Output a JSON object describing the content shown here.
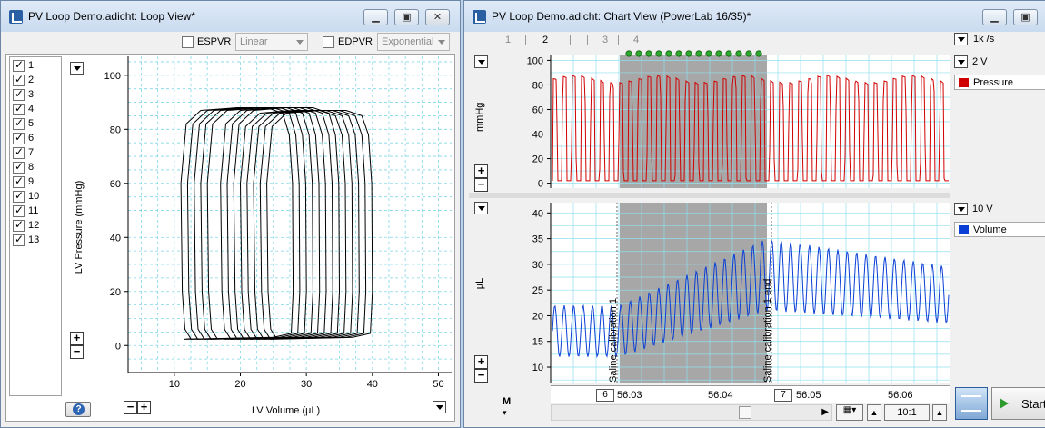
{
  "loop_window": {
    "title": "PV Loop Demo.adicht: Loop View*",
    "espvr": {
      "label": "ESPVR",
      "checked": false,
      "mode": "Linear"
    },
    "edpvr": {
      "label": "EDPVR",
      "checked": false,
      "mode": "Exponential"
    },
    "loops": [
      {
        "label": "1",
        "checked": true
      },
      {
        "label": "2",
        "checked": true
      },
      {
        "label": "3",
        "checked": true
      },
      {
        "label": "4",
        "checked": true
      },
      {
        "label": "5",
        "checked": true
      },
      {
        "label": "6",
        "checked": true
      },
      {
        "label": "7",
        "checked": true
      },
      {
        "label": "8",
        "checked": true
      },
      {
        "label": "9",
        "checked": true
      },
      {
        "label": "10",
        "checked": true
      },
      {
        "label": "11",
        "checked": true
      },
      {
        "label": "12",
        "checked": true
      },
      {
        "label": "13",
        "checked": true
      }
    ],
    "plot": {
      "xlabel": "LV Volume (µL)",
      "ylabel": "LV Pressure (mmHg)",
      "xticks": [
        10,
        20,
        30,
        40,
        50
      ],
      "yticks": [
        0,
        20,
        40,
        60,
        80,
        100
      ],
      "xlim": [
        3,
        52
      ],
      "ylim": [
        -10,
        107
      ]
    }
  },
  "chart_window": {
    "title": "PV Loop Demo.adicht: Chart View (PowerLab 16/35)*",
    "sample_rate": "1k /s",
    "blocks": [
      "1",
      "2",
      "3",
      "4"
    ],
    "channels": [
      {
        "name": "Pressure",
        "unit": "mmHg",
        "range": "2 V",
        "color": "#d10000",
        "yticks": [
          0,
          20,
          40,
          60,
          80,
          100
        ],
        "ylim": [
          -4,
          104
        ]
      },
      {
        "name": "Volume",
        "unit": "µL",
        "range": "10 V",
        "color": "#0a3fd6",
        "yticks": [
          10,
          15,
          20,
          25,
          30,
          35,
          40
        ],
        "ylim": [
          7,
          42
        ]
      }
    ],
    "time_ticks": [
      "56:03",
      "56:04",
      "56:05",
      "56:06"
    ],
    "comments": [
      {
        "number": "6",
        "text": "Saline calibration 1"
      },
      {
        "number": "7",
        "text": "Saline calibration 1 end"
      }
    ],
    "zoom": "10:1",
    "start_label": "Start"
  },
  "chart_data": [
    {
      "type": "line",
      "title": "",
      "xlabel": "LV Volume (µL)",
      "ylabel": "LV Pressure (mmHg)",
      "xlim": [
        3,
        52
      ],
      "ylim": [
        -10,
        107
      ],
      "grid": true,
      "description_of_series": "13 pressure-volume loops",
      "series": [
        {
          "name": "1",
          "x_range": [
            24,
            40
          ],
          "y_range": [
            2,
            87
          ]
        },
        {
          "name": "2",
          "x_range": [
            23,
            39
          ],
          "y_range": [
            2,
            87
          ]
        },
        {
          "name": "3",
          "x_range": [
            22,
            38
          ],
          "y_range": [
            2,
            87
          ]
        },
        {
          "name": "4",
          "x_range": [
            21,
            37
          ],
          "y_range": [
            2,
            87
          ]
        },
        {
          "name": "5",
          "x_range": [
            20,
            36
          ],
          "y_range": [
            2,
            87
          ]
        },
        {
          "name": "6",
          "x_range": [
            19,
            35
          ],
          "y_range": [
            2,
            88
          ]
        },
        {
          "name": "7",
          "x_range": [
            18,
            34
          ],
          "y_range": [
            2,
            88
          ]
        },
        {
          "name": "8",
          "x_range": [
            17,
            33
          ],
          "y_range": [
            2,
            88
          ]
        },
        {
          "name": "9",
          "x_range": [
            15,
            32
          ],
          "y_range": [
            2,
            88
          ]
        },
        {
          "name": "10",
          "x_range": [
            14,
            31
          ],
          "y_range": [
            2,
            88
          ]
        },
        {
          "name": "11",
          "x_range": [
            13,
            30
          ],
          "y_range": [
            2,
            88
          ]
        },
        {
          "name": "12",
          "x_range": [
            12,
            29
          ],
          "y_range": [
            2,
            88
          ]
        },
        {
          "name": "13",
          "x_range": [
            11,
            28
          ],
          "y_range": [
            2,
            88
          ]
        }
      ]
    },
    {
      "type": "line",
      "title": "",
      "ylabel": "mmHg",
      "ylim": [
        -4,
        104
      ],
      "series": [
        {
          "name": "Pressure",
          "min": 2,
          "max": 88,
          "cycles": 42
        }
      ]
    },
    {
      "type": "line",
      "title": "",
      "ylabel": "µL",
      "ylim": [
        7,
        42
      ],
      "series": [
        {
          "name": "Volume",
          "min": 10,
          "max": 40,
          "cycles": 42
        }
      ]
    }
  ]
}
